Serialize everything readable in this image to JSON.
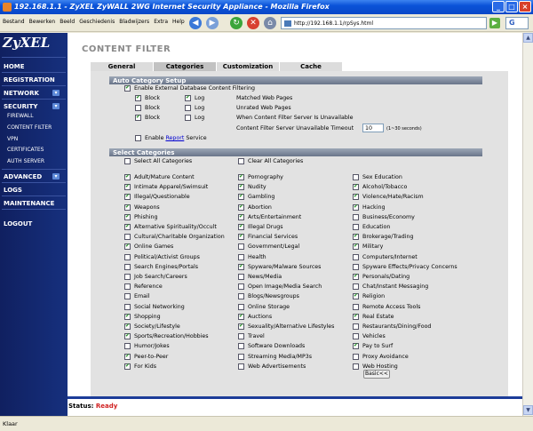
{
  "window": {
    "title": "192.168.1.1 - ZyXEL ZyWALL 2WG Internet Security Appliance - Mozilla Firefox",
    "minimize": "_",
    "maximize": "□",
    "close": "×"
  },
  "browser": {
    "menu": [
      "Bestand",
      "Bewerken",
      "Beeld",
      "Geschiedenis",
      "Bladwijzers",
      "Extra",
      "Help"
    ],
    "back_icon": "◀",
    "forward_icon": "▶",
    "reload_icon": "↻",
    "stop_icon": "✕",
    "home_icon": "⌂",
    "url": "http://192.168.1.1/rpSys.html",
    "go_icon": "▶",
    "search_engine": "G",
    "status_text": "Klaar"
  },
  "sidebar": {
    "logo": "ZyXEL",
    "toggle_glyph": "▾",
    "items": [
      {
        "label": "HOME"
      },
      {
        "label": "REGISTRATION"
      },
      {
        "label": "NETWORK"
      },
      {
        "label": "SECURITY"
      },
      {
        "label": "FIREWALL"
      },
      {
        "label": "CONTENT FILTER"
      },
      {
        "label": "VPN"
      },
      {
        "label": "CERTIFICATES"
      },
      {
        "label": "AUTH SERVER"
      },
      {
        "label": "ADVANCED"
      },
      {
        "label": "LOGS"
      },
      {
        "label": "MAINTENANCE"
      },
      {
        "label": "LOGOUT"
      }
    ]
  },
  "page": {
    "title": "CONTENT FILTER",
    "tabs": [
      {
        "label": "General"
      },
      {
        "label": "Categories",
        "active": true
      },
      {
        "label": "Customization"
      },
      {
        "label": "Cache"
      }
    ]
  },
  "auto_category": {
    "header": "Auto Category Setup",
    "enable_label": "Enable External Database Content Filtering",
    "enable_checked": true,
    "rules": [
      {
        "block_label": "Block",
        "block": true,
        "log_label": "Log",
        "log": true,
        "desc": "Matched Web Pages"
      },
      {
        "block_label": "Block",
        "block": false,
        "log_label": "Log",
        "log": false,
        "desc": "Unrated Web Pages"
      },
      {
        "block_label": "Block",
        "block": true,
        "log_label": "Log",
        "log": false,
        "desc": "When Content Filter Server Is Unavailable"
      }
    ],
    "timeout_label": "Content Filter Server Unavailable Timeout",
    "timeout_value": "10",
    "timeout_hint": "(1~30 seconds)",
    "report_prefix": "Enable",
    "report_link": "Report",
    "report_suffix": "Service",
    "report_checked": false
  },
  "select_categories": {
    "header": "Select Categories",
    "select_all": "Select All Categories",
    "clear_all": "Clear All Categories",
    "columns": [
      [
        {
          "label": "Adult/Mature Content",
          "checked": true
        },
        {
          "label": "Intimate Apparel/Swimsuit",
          "checked": true
        },
        {
          "label": "Illegal/Questionable",
          "checked": true
        },
        {
          "label": "Weapons",
          "checked": true
        },
        {
          "label": "Phishing",
          "checked": true
        },
        {
          "label": "Alternative Spirituality/Occult",
          "checked": true
        },
        {
          "label": "Cultural/Charitable Organization",
          "checked": false
        },
        {
          "label": "Online Games",
          "checked": true
        },
        {
          "label": "Political/Activist Groups",
          "checked": false
        },
        {
          "label": "Search Engines/Portals",
          "checked": false
        },
        {
          "label": "Job Search/Careers",
          "checked": false
        },
        {
          "label": "Reference",
          "checked": false
        },
        {
          "label": "Email",
          "checked": false
        },
        {
          "label": "Social Networking",
          "checked": false
        },
        {
          "label": "Shopping",
          "checked": true
        },
        {
          "label": "Society/Lifestyle",
          "checked": true
        },
        {
          "label": "Sports/Recreation/Hobbies",
          "checked": true
        },
        {
          "label": "Humor/Jokes",
          "checked": false
        },
        {
          "label": "Peer-to-Peer",
          "checked": true
        },
        {
          "label": "For Kids",
          "checked": true
        }
      ],
      [
        {
          "label": "Pornography",
          "checked": true
        },
        {
          "label": "Nudity",
          "checked": true
        },
        {
          "label": "Gambling",
          "checked": true
        },
        {
          "label": "Abortion",
          "checked": true
        },
        {
          "label": "Arts/Entertainment",
          "checked": true
        },
        {
          "label": "Illegal Drugs",
          "checked": true
        },
        {
          "label": "Financial Services",
          "checked": true
        },
        {
          "label": "Government/Legal",
          "checked": false
        },
        {
          "label": "Health",
          "checked": false
        },
        {
          "label": "Spyware/Malware Sources",
          "checked": true
        },
        {
          "label": "News/Media",
          "checked": false
        },
        {
          "label": "Open Image/Media Search",
          "checked": false
        },
        {
          "label": "Blogs/Newsgroups",
          "checked": false
        },
        {
          "label": "Online Storage",
          "checked": false
        },
        {
          "label": "Auctions",
          "checked": true
        },
        {
          "label": "Sexuality/Alternative Lifestyles",
          "checked": true
        },
        {
          "label": "Travel",
          "checked": false
        },
        {
          "label": "Software Downloads",
          "checked": false
        },
        {
          "label": "Streaming Media/MP3s",
          "checked": false
        },
        {
          "label": "Web Advertisements",
          "checked": false
        }
      ],
      [
        {
          "label": "Sex Education",
          "checked": false
        },
        {
          "label": "Alcohol/Tobacco",
          "checked": true
        },
        {
          "label": "Violence/Hate/Racism",
          "checked": true
        },
        {
          "label": "Hacking",
          "checked": true
        },
        {
          "label": "Business/Economy",
          "checked": false
        },
        {
          "label": "Education",
          "checked": false
        },
        {
          "label": "Brokerage/Trading",
          "checked": true
        },
        {
          "label": "Military",
          "checked": true
        },
        {
          "label": "Computers/Internet",
          "checked": false
        },
        {
          "label": "Spyware Effects/Privacy Concerns",
          "checked": false
        },
        {
          "label": "Personals/Dating",
          "checked": true
        },
        {
          "label": "Chat/Instant Messaging",
          "checked": false
        },
        {
          "label": "Religion",
          "checked": true
        },
        {
          "label": "Remote Access Tools",
          "checked": false
        },
        {
          "label": "Real Estate",
          "checked": true
        },
        {
          "label": "Restaurants/Dining/Food",
          "checked": false
        },
        {
          "label": "Vehicles",
          "checked": false
        },
        {
          "label": "Pay to Surf",
          "checked": true
        },
        {
          "label": "Proxy Avoidance",
          "checked": false
        },
        {
          "label": "Web Hosting",
          "checked": false
        }
      ]
    ],
    "basic_button": "Basic<<"
  },
  "status": {
    "label": "Status:",
    "value": "Ready"
  },
  "colors": {
    "sidebar": "#16307e",
    "header_bar": "#69758a",
    "status_value": "#d02020",
    "check": "#1a8a1a"
  }
}
